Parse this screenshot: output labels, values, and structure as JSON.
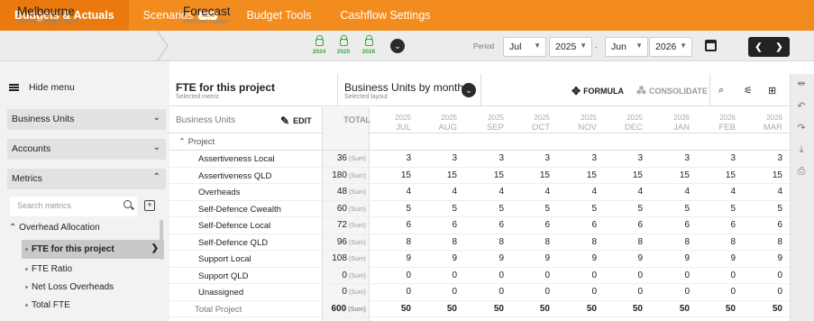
{
  "topnav": {
    "tabs": [
      {
        "label": "Budgets & Actuals"
      },
      {
        "label": "Scenarios",
        "badge": "NEW"
      },
      {
        "label": "Budget Tools"
      },
      {
        "label": "Cashflow Settings"
      }
    ],
    "brand_color": "#f28c1e"
  },
  "subheader": {
    "organisation": "Melbourne",
    "organisation_caption": "Selected organisation",
    "budget": "Forecast",
    "budget_caption": "Selected budget",
    "locked_years": [
      "2024",
      "2025",
      "2026"
    ],
    "period_label": "Period",
    "from_month": "Jul",
    "from_year": "2025",
    "to_month": "Jun",
    "to_year": "2026"
  },
  "sidebar": {
    "hide_menu": "Hide menu",
    "panels": [
      "Business Units",
      "Accounts",
      "Metrics"
    ],
    "search_placeholder": "Search metrics",
    "group": "Overhead Allocation",
    "metrics": [
      "FTE for this project",
      "FTE Ratio",
      "Net Loss Overheads",
      "Total FTE"
    ]
  },
  "toolbar": {
    "metric_title": "FTE for this project",
    "metric_caption": "Selected metric",
    "layout_title": "Business Units by month",
    "layout_caption": "Selected layout",
    "formula_label": "FORMULA",
    "consolidate_label": "CONSOLIDATE"
  },
  "grid": {
    "rows_header": "Business Units",
    "edit_label": "EDIT",
    "total_header": "TOTAL",
    "months": [
      {
        "y": "2025",
        "m": "JUL"
      },
      {
        "y": "2025",
        "m": "AUG"
      },
      {
        "y": "2025",
        "m": "SEP"
      },
      {
        "y": "2025",
        "m": "OCT"
      },
      {
        "y": "2025",
        "m": "NOV"
      },
      {
        "y": "2025",
        "m": "DEC"
      },
      {
        "y": "2026",
        "m": "JAN"
      },
      {
        "y": "2026",
        "m": "FEB"
      },
      {
        "y": "2026",
        "m": "MAR"
      }
    ],
    "group_label": "Project",
    "sum_tag": "(Sum)",
    "rows": [
      {
        "name": "Assertiveness Local",
        "total": "36",
        "values": [
          "3",
          "3",
          "3",
          "3",
          "3",
          "3",
          "3",
          "3",
          "3"
        ]
      },
      {
        "name": "Assertiveness QLD",
        "total": "180",
        "values": [
          "15",
          "15",
          "15",
          "15",
          "15",
          "15",
          "15",
          "15",
          "15"
        ]
      },
      {
        "name": "Overheads",
        "total": "48",
        "values": [
          "4",
          "4",
          "4",
          "4",
          "4",
          "4",
          "4",
          "4",
          "4"
        ]
      },
      {
        "name": "Self-Defence Cwealth",
        "total": "60",
        "values": [
          "5",
          "5",
          "5",
          "5",
          "5",
          "5",
          "5",
          "5",
          "5"
        ]
      },
      {
        "name": "Self-Defence Local",
        "total": "72",
        "values": [
          "6",
          "6",
          "6",
          "6",
          "6",
          "6",
          "6",
          "6",
          "6"
        ]
      },
      {
        "name": "Self-Defence QLD",
        "total": "96",
        "values": [
          "8",
          "8",
          "8",
          "8",
          "8",
          "8",
          "8",
          "8",
          "8"
        ]
      },
      {
        "name": "Support Local",
        "total": "108",
        "values": [
          "9",
          "9",
          "9",
          "9",
          "9",
          "9",
          "9",
          "9",
          "9"
        ]
      },
      {
        "name": "Support QLD",
        "total": "0",
        "values": [
          "0",
          "0",
          "0",
          "0",
          "0",
          "0",
          "0",
          "0",
          "0"
        ]
      },
      {
        "name": "Unassigned",
        "total": "0",
        "values": [
          "0",
          "0",
          "0",
          "0",
          "0",
          "0",
          "0",
          "0",
          "0"
        ]
      }
    ],
    "total_row": {
      "name": "Total Project",
      "total": "600",
      "values": [
        "50",
        "50",
        "50",
        "50",
        "50",
        "50",
        "50",
        "50",
        "50"
      ]
    }
  }
}
